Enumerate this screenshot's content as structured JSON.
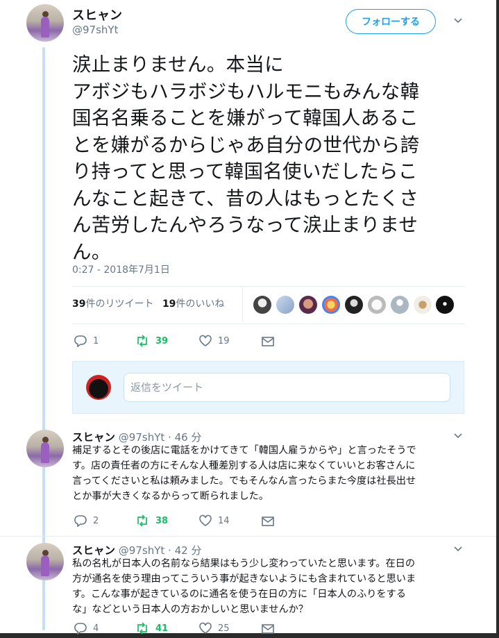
{
  "tweet": {
    "name": "スヒャン",
    "handle": "@97shYt",
    "follow_label": "フォローする",
    "text_lines": [
      "涙止まりません。本当に",
      "アボジもハラボジもハルモニもみんな韓",
      "国名名乗ることを嫌がって韓国人あるこ",
      "とを嫌がるからじゃあ自分の世代から誇",
      "り持ってと思って韓国名使いだしたらこ",
      "んなこと起きて、昔の人はもっとたくさ",
      "ん苦労したんやろうなって涙止まりませ",
      "ん。"
    ],
    "timestamp": "0:27 - 2018年7月1日",
    "retweets_num": "39",
    "retweets_label": "件のリツイート",
    "likes_num": "19",
    "likes_label": "件のいいね",
    "actions": {
      "reply": "1",
      "retweet": "39",
      "like": "19"
    },
    "reply_placeholder": "返信をツイート"
  },
  "replies": [
    {
      "name": "スヒャン",
      "handle": "@97shYt",
      "time": "· 46 分",
      "lines": [
        "補足するとその後店に電話をかけてきて「韓国人雇うからや」と言ったそうで",
        "す。店の責任者の方にそんな人種差別する人は店に来なくていいとお客さんに",
        "言ってくださいと私は頼みました。でもそんなん言ったらまた今度は社長出せ",
        "とか事が大きくなるからって断られました。"
      ],
      "actions": {
        "reply": "2",
        "retweet": "38",
        "like": "14"
      }
    },
    {
      "name": "スヒャン",
      "handle": "@97shYt",
      "time": "· 42 分",
      "lines": [
        "私の名札が日本人の名前なら結果はもう少し変わっていたと思います。在日の",
        "方が通名を使う理由ってこういう事が起きないようにも含まれていると思いま",
        "す。こんな事が起きているのに通名を使う在日の方に「日本人のふりをする",
        "な」などという日本人の方おかしいと思いませんか？"
      ],
      "actions": {
        "reply": "4",
        "retweet": "41",
        "like": "25"
      }
    }
  ],
  "colors": {
    "accent": "#1da1f2",
    "retweet_green": "#17bf63",
    "muted": "#657786",
    "thread_line": "#c4dff6"
  },
  "icons": [
    "reply-icon",
    "retweet-icon",
    "like-icon",
    "mail-icon",
    "chevron-down-icon"
  ]
}
